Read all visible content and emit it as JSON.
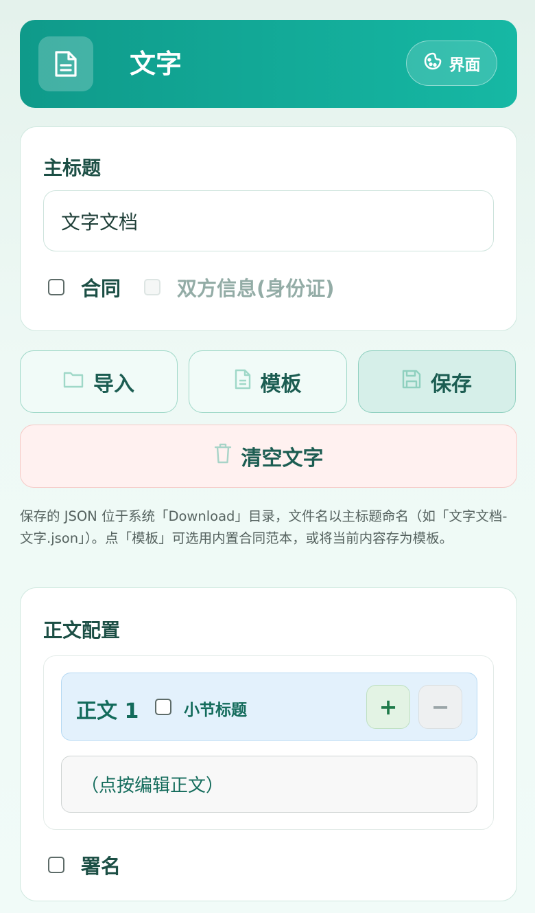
{
  "header": {
    "title": "文字",
    "theme_label": "界面"
  },
  "main_title": {
    "section_label": "主标题",
    "value": "文字文档"
  },
  "options": {
    "contract_label": "合同",
    "parties_label": "双方信息(身份证)"
  },
  "actions": {
    "import_label": "导入",
    "template_label": "模板",
    "save_label": "保存",
    "clear_label": "清空文字"
  },
  "hint": "保存的 JSON 位于系统「Download」目录，文件名以主标题命名（如「文字文档-文字.json」）。点「模板」可选用内置合同范本，或将当前内容存为模板。",
  "body_config": {
    "section_label": "正文配置",
    "item_name": "正文 1",
    "subtitle_label": "小节标题",
    "add_symbol": "+",
    "remove_symbol": "−",
    "edit_placeholder": "（点按编辑正文）",
    "signature_label": "署名"
  },
  "colors": {
    "brand": "#16b8a4",
    "brand_dark": "#0f9a8a",
    "danger_bg": "#fff1f0"
  },
  "icons": {
    "app": "document-icon",
    "theme": "palette-icon",
    "import": "folder-icon",
    "template": "file-icon",
    "save": "floppy-icon",
    "clear": "trash-icon"
  }
}
